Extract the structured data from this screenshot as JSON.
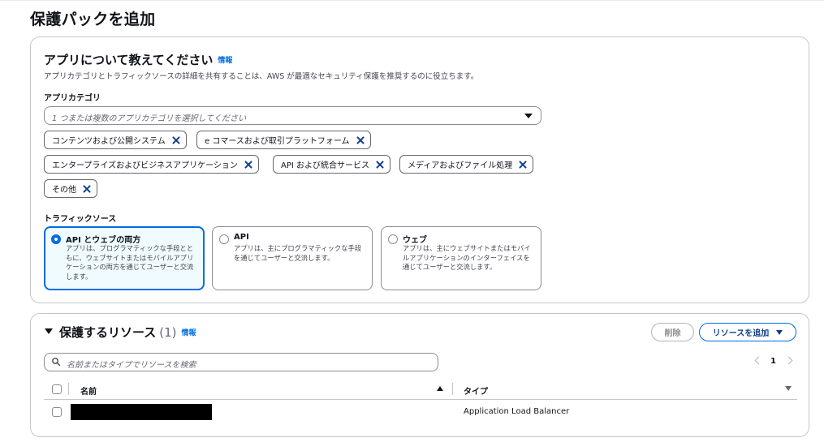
{
  "page": {
    "title": "保護パックを追加"
  },
  "app_section": {
    "title": "アプリについて教えてください",
    "info_link": "情報",
    "description": "アプリカテゴリとトラフィックソースの詳細を共有することは、AWS が最適なセキュリティ保護を推奨するのに役立ちます。",
    "category_label": "アプリカテゴリ",
    "category_placeholder": "1 つまたは複数のアプリカテゴリを選択してください",
    "tags": [
      "コンテンツおよび公開システム",
      "e コマースおよび取引プラットフォーム",
      "エンタープライズおよびビジネスアプリケーション",
      "API および統合サービス",
      "メディアおよびファイル処理",
      "その他"
    ],
    "traffic_label": "トラフィックソース",
    "traffic_options": [
      {
        "title": "API とウェブの両方",
        "desc": "アプリは、プログラマティックな手段とともに、ウェブサイトまたはモバイルアプリケーションの両方を通じてユーザーと交流します。",
        "selected": true
      },
      {
        "title": "API",
        "desc": "アプリは、主にプログラマティックな手段を通じてユーザーと交流します。",
        "selected": false
      },
      {
        "title": "ウェブ",
        "desc": "アプリは、主にウェブサイトまたはモバイルアプリケーションのインターフェイスを通じてユーザーと交流します。",
        "selected": false
      }
    ]
  },
  "resources": {
    "title": "保護するリソース",
    "count": "(1)",
    "info_link": "情報",
    "delete_label": "削除",
    "add_label": "リソースを追加",
    "search_placeholder": "名前またはタイプでリソースを検索",
    "page_number": "1",
    "columns": {
      "name": "名前",
      "type": "タイプ"
    },
    "rows": [
      {
        "name_redacted": true,
        "type": "Application Load Balancer"
      }
    ]
  },
  "colors": {
    "accent": "#006ce0",
    "selected_tile_bg": "#f0fbff",
    "text": "#0f141a"
  }
}
